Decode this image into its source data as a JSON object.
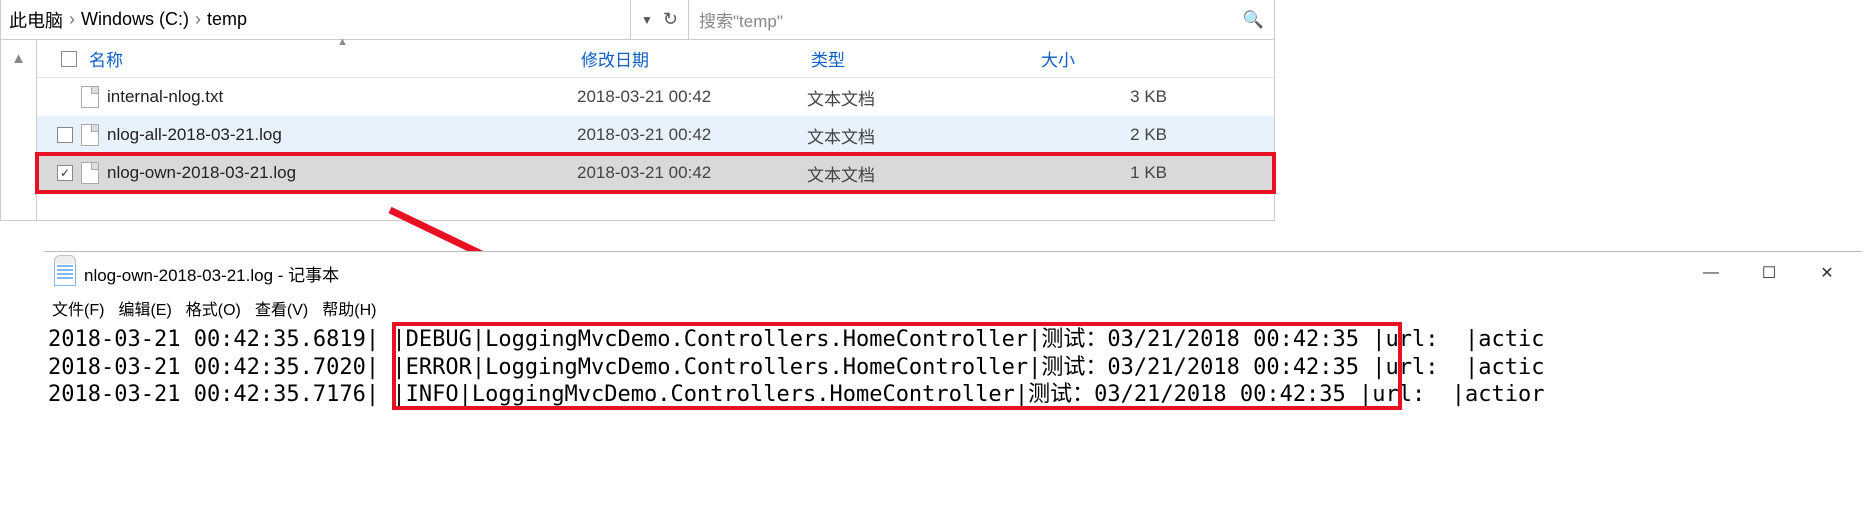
{
  "explorer": {
    "breadcrumb": [
      "此电脑",
      "Windows (C:)",
      "temp"
    ],
    "search_placeholder": "搜索\"temp\"",
    "columns": {
      "name": "名称",
      "modified": "修改日期",
      "type": "类型",
      "size": "大小"
    },
    "rows": [
      {
        "name": "internal-nlog.txt",
        "modified": "2018-03-21 00:42",
        "type": "文本文档",
        "size": "3 KB",
        "state": "normal"
      },
      {
        "name": "nlog-all-2018-03-21.log",
        "modified": "2018-03-21 00:42",
        "type": "文本文档",
        "size": "2 KB",
        "state": "hover"
      },
      {
        "name": "nlog-own-2018-03-21.log",
        "modified": "2018-03-21 00:42",
        "type": "文本文档",
        "size": "1 KB",
        "state": "selected"
      }
    ]
  },
  "notepad": {
    "title": "nlog-own-2018-03-21.log - 记事本",
    "menu": [
      "文件(F)",
      "编辑(E)",
      "格式(O)",
      "查看(V)",
      "帮助(H)"
    ],
    "lines": [
      {
        "ts": "2018-03-21 00:42:35.6819",
        "level": "DEBUG",
        "logger": "LoggingMvcDemo.Controllers.HomeController",
        "msg": "测试：03/21/2018 00:42:35",
        "tail": "url:  |actic"
      },
      {
        "ts": "2018-03-21 00:42:35.7020",
        "level": "ERROR",
        "logger": "LoggingMvcDemo.Controllers.HomeController",
        "msg": "测试：03/21/2018 00:42:35",
        "tail": "url:  |actic"
      },
      {
        "ts": "2018-03-21 00:42:35.7176",
        "level": "INFO",
        "logger": "LoggingMvcDemo.Controllers.HomeController",
        "msg": "测试：03/21/2018 00:42:35",
        "tail": "url:  |actior"
      }
    ]
  },
  "winbtn": {
    "min": "—",
    "max": "☐",
    "close": "✕"
  }
}
